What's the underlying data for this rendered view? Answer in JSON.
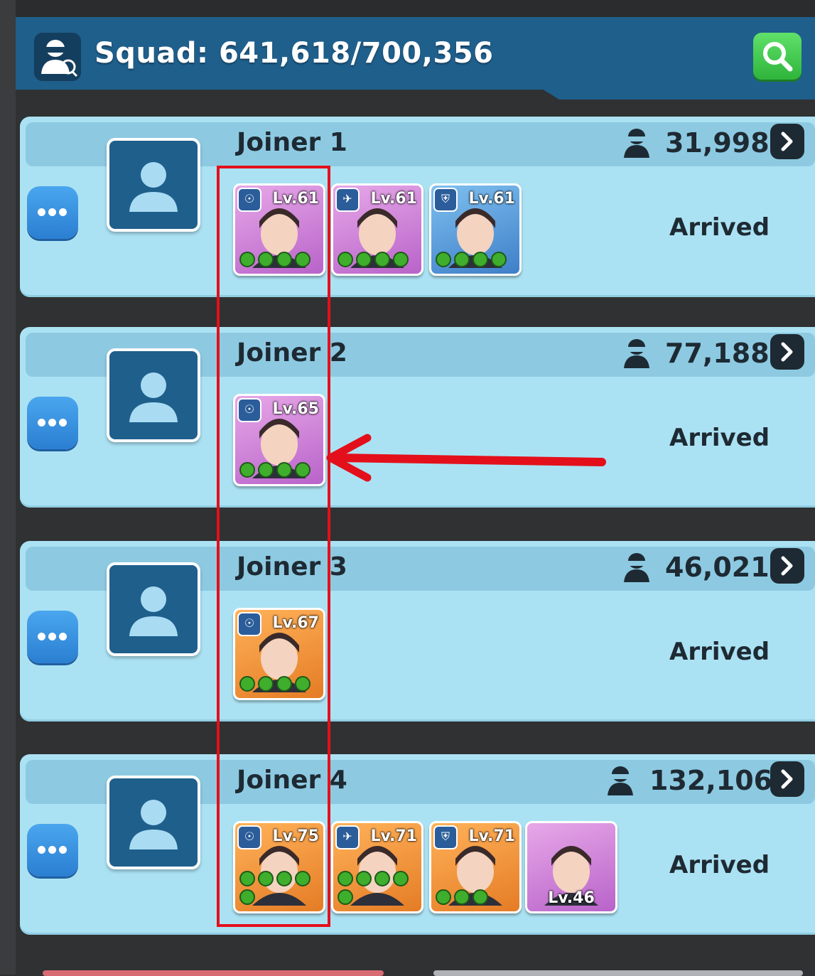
{
  "header": {
    "title": "Squad: 641,618/700,356",
    "squad_icon": "soldier-search-icon",
    "search_icon": "magnifier-icon"
  },
  "joiners": [
    {
      "name": "Joiner 1",
      "power": "31,998",
      "status": "Arrived",
      "heroes": [
        {
          "level": "Lv.61",
          "stars": 4,
          "frame": "purple"
        },
        {
          "level": "Lv.61",
          "stars": 4,
          "frame": "purple"
        },
        {
          "level": "Lv.61",
          "stars": 4,
          "frame": "blue"
        }
      ]
    },
    {
      "name": "Joiner 2",
      "power": "77,188",
      "status": "Arrived",
      "heroes": [
        {
          "level": "Lv.65",
          "stars": 4,
          "frame": "purple"
        }
      ]
    },
    {
      "name": "Joiner 3",
      "power": "46,021",
      "status": "Arrived",
      "heroes": [
        {
          "level": "Lv.67",
          "stars": 4,
          "frame": "orange"
        }
      ]
    },
    {
      "name": "Joiner 4",
      "power": "132,106",
      "status": "Arrived",
      "heroes": [
        {
          "level": "Lv.75",
          "stars": 5,
          "frame": "orange"
        },
        {
          "level": "Lv.71",
          "stars": 5,
          "frame": "orange"
        },
        {
          "level": "Lv.71",
          "stars": 3,
          "frame": "orange"
        },
        {
          "level": "Lv.46",
          "stars": 0,
          "frame": "purple"
        }
      ]
    }
  ],
  "colors": {
    "header_bg": "#1f5f8c",
    "card_bg": "#abe2f3",
    "annotation": "#e3101b",
    "search_green": "#3cc847"
  }
}
